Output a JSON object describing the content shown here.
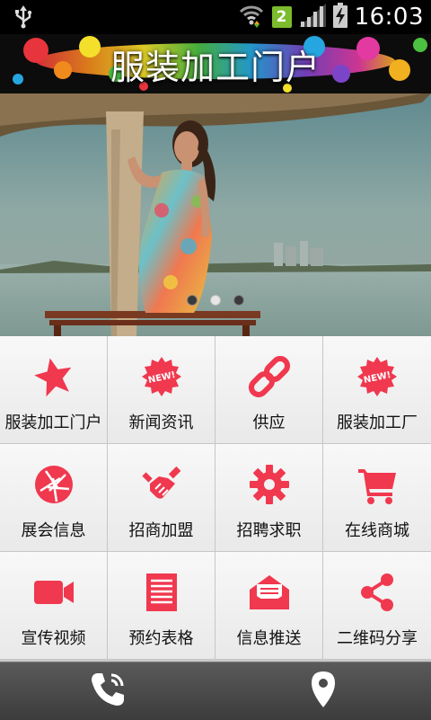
{
  "status_bar": {
    "time": "16:03",
    "sim_slot": "2",
    "icons": [
      "usb-icon",
      "wifi-icon",
      "signal-icon",
      "battery-charging-icon"
    ]
  },
  "header": {
    "title": "服装加工门户"
  },
  "carousel": {
    "slide_count": 3,
    "active_index": 1
  },
  "menu": {
    "items": [
      {
        "label": "服装加工门户",
        "icon": "star-icon"
      },
      {
        "label": "新闻资讯",
        "icon": "new-badge-icon"
      },
      {
        "label": "供应",
        "icon": "link-icon"
      },
      {
        "label": "服装加工厂",
        "icon": "new-badge-icon"
      },
      {
        "label": "展会信息",
        "icon": "aperture-icon"
      },
      {
        "label": "招商加盟",
        "icon": "handshake-icon"
      },
      {
        "label": "招聘求职",
        "icon": "gear-icon"
      },
      {
        "label": "在线商城",
        "icon": "cart-icon"
      },
      {
        "label": "宣传视频",
        "icon": "video-camera-icon"
      },
      {
        "label": "预约表格",
        "icon": "form-icon"
      },
      {
        "label": "信息推送",
        "icon": "mail-icon"
      },
      {
        "label": "二维码分享",
        "icon": "share-icon"
      }
    ],
    "accent_color": "#f0384f"
  },
  "bottom_bar": {
    "buttons": [
      {
        "icon": "phone-icon"
      },
      {
        "icon": "map-pin-icon"
      }
    ]
  }
}
